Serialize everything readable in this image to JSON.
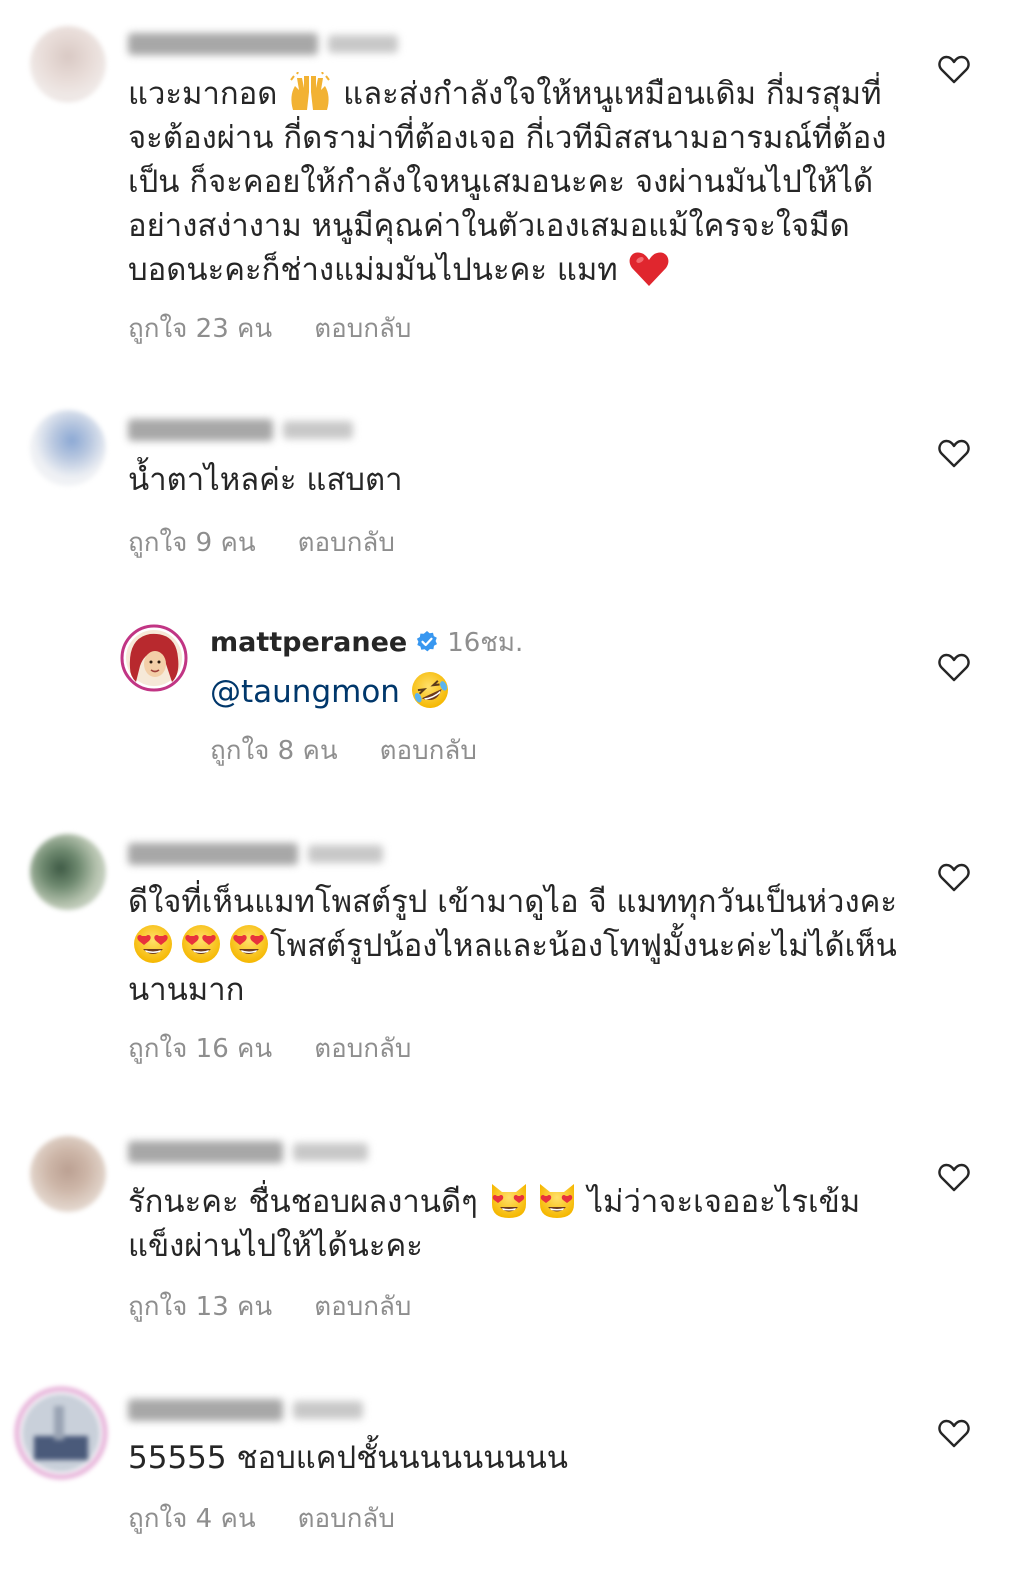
{
  "comments": [
    {
      "text_parts": [
        "แวะมากอด ",
        " และส่งกำลังใจให้หนูเหมือนเดิม กี่มรสุมที่จะต้องผ่าน กี่ดราม่าที่ต้องเจอ กี่เวทีมิสสนามอารมณ์ที่ต้องเป็น ก็จะคอยให้กำลังใจหนูเสมอนะคะ จงผ่านมันไปให้ได้อย่างสง่างาม หนูมีคุณค่าในตัวเองเสมอแม้ใครจะใจมืดบอดนะคะก็ช่างแม่มมันไปนะคะ แมท "
      ],
      "emojis": [
        "raising-hands-emoji",
        "red-heart-emoji"
      ],
      "likes": "ถูกใจ 23 คน",
      "reply": "ตอบกลับ"
    },
    {
      "text": "น้ำตาไหลค่ะ แสบตา",
      "likes": "ถูกใจ 9 คน",
      "reply": "ตอบกลับ"
    },
    {
      "username": "mattperanee",
      "time": "16ชม.",
      "mention": "@taungmon",
      "emoji": "rolling-on-floor-laughing-emoji",
      "likes": "ถูกใจ 8 คน",
      "reply": "ตอบกลับ"
    },
    {
      "text_parts": [
        "ดีใจที่เห็นแมทโพสต์รูป เข้ามาดูไอ จี แมททุกวันเป็นห่วงคะ",
        "โพสต์รูปน้องไหลและน้องโทฟูมั้งนะค่ะไม่ได้เห็นนานมาก"
      ],
      "emojis": [
        "heart-eyes-emoji",
        "heart-eyes-emoji",
        "heart-eyes-emoji"
      ],
      "likes": "ถูกใจ 16 คน",
      "reply": "ตอบกลับ"
    },
    {
      "text_parts": [
        "รักนะคะ ชื่นชอบผลงานดีๆ ",
        " ไม่ว่าจะเจออะไรเข้มแข็งผ่านไปให้ได้นะคะ"
      ],
      "emojis": [
        "heart-eyes-cat-emoji",
        "heart-eyes-cat-emoji"
      ],
      "likes": "ถูกใจ 13 คน",
      "reply": "ตอบกลับ"
    },
    {
      "text": "55555 ชอบแคปชั้นนนนนนนนน",
      "likes": "ถูกใจ 4 คน",
      "reply": "ตอบกลับ"
    }
  ],
  "colors": {
    "text": "#262626",
    "secondary": "#8e8e8e",
    "mention": "#00376b",
    "verified": "#3897f0"
  },
  "icons": [
    "heart-outline-icon",
    "verified-badge-icon"
  ]
}
